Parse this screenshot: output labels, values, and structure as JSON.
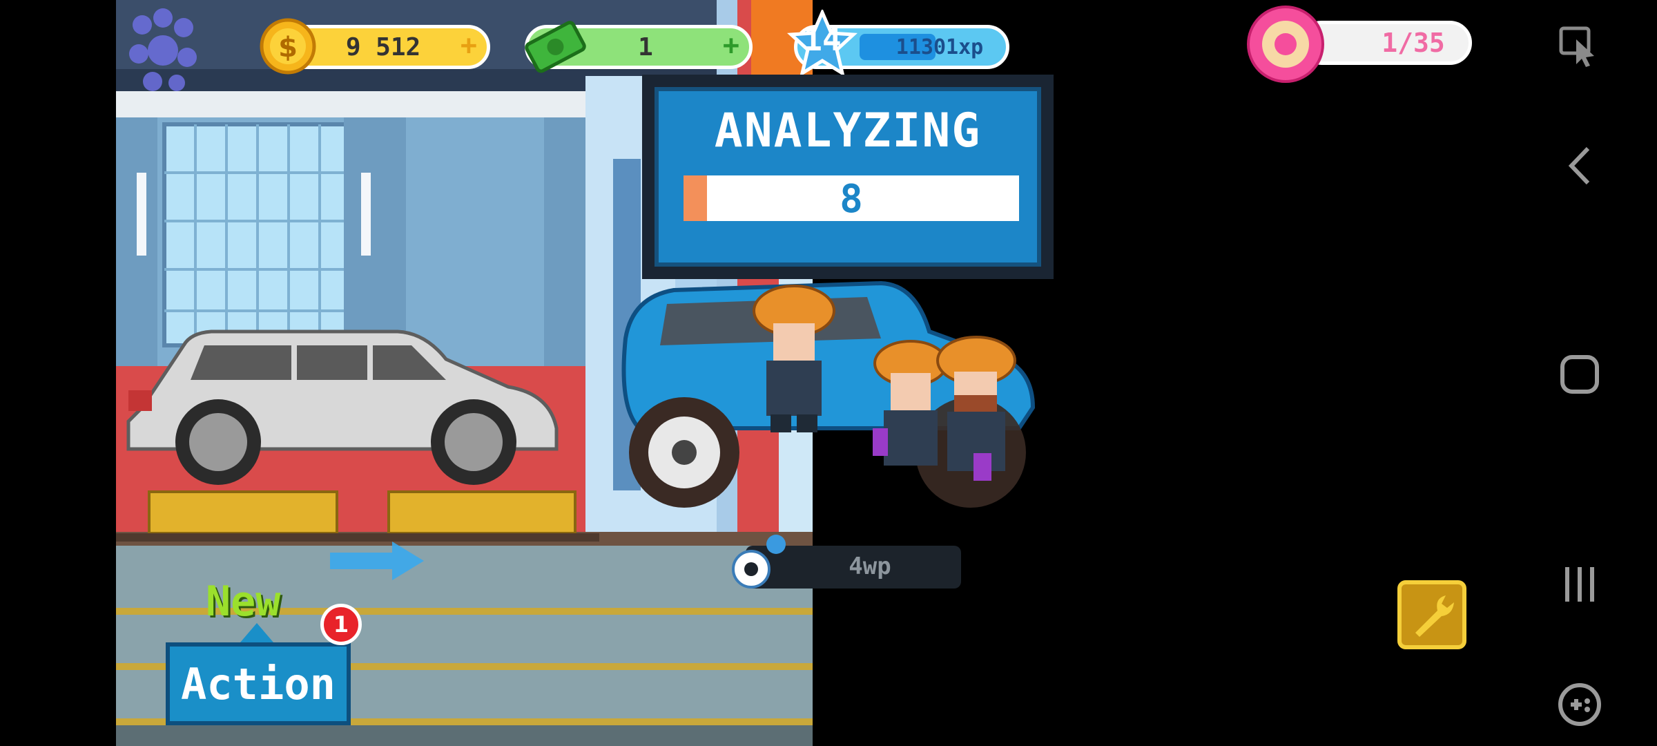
{
  "hud": {
    "coins": "9 512",
    "cash": "1",
    "level": "14",
    "xp": "11301xp",
    "donuts": "1/35",
    "plus_symbol": "+"
  },
  "panel": {
    "title": "ANALYZING",
    "value": "8",
    "progress": 0.07
  },
  "wp_label": "4wp",
  "action": {
    "new_label": "New",
    "button_label": "Action",
    "badge_count": "1"
  },
  "colors": {
    "coin_pill": "#FCD23A",
    "cash_pill": "#8EE27A",
    "xp_pill": "#5CC8F2",
    "donut_pill": "#F2F2F2",
    "panel_blue": "#1C86C8",
    "action_blue": "#1A8FC8",
    "new_green": "#9BE02C",
    "badge_red": "#E8232A"
  },
  "icons": [
    "paw-cluster-icon",
    "coin-icon",
    "cash-icon",
    "level-star-icon",
    "donut-icon",
    "gear-icon",
    "wrench-icon",
    "blue-arrow-icon",
    "cursor-icon",
    "back-icon",
    "home-icon",
    "recents-icon",
    "gamepad-icon"
  ]
}
